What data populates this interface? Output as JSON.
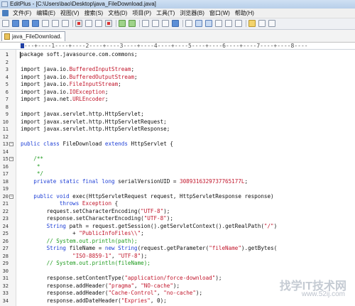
{
  "window": {
    "title": "EditPlus - [C:\\Users\\bao\\Desktop\\java_FileDownload.java]"
  },
  "menu": {
    "items": [
      "文件(F)",
      "编辑(E)",
      "视图(V)",
      "搜索(S)",
      "文档(D)",
      "项目(P)",
      "工具(T)",
      "浏览器(B)",
      "窗口(W)",
      "帮助(H)"
    ]
  },
  "toolbar": {
    "icons": [
      "new-file-icon",
      "open-icon",
      "save-icon",
      "save-all-icon",
      "print-icon",
      "print-preview-icon",
      "spellcheck-icon",
      "cut-icon",
      "copy-icon",
      "paste-icon",
      "delete-icon",
      "undo-icon",
      "redo-icon",
      "find-icon",
      "replace-icon",
      "goto-icon",
      "browser-icon",
      "word-wrap-icon",
      "line-number-icon",
      "ruler-icon",
      "column-select-icon",
      "whitespace-icon",
      "hex-icon",
      "options-icon",
      "user-tool-icon",
      "help-icon"
    ]
  },
  "tabs": [
    {
      "label": "java_FileDownload.",
      "active": true
    }
  ],
  "ruler": {
    "text": "----+----1----+----2----+----3----+----4----+----5----+----6----+----7----+----8----"
  },
  "editor": {
    "current_line": 1,
    "lines": [
      {
        "n": "1",
        "fold": "",
        "segs": [
          [
            "",
            "package soft.javasource.com.commons;"
          ]
        ]
      },
      {
        "n": "2",
        "fold": "",
        "segs": []
      },
      {
        "n": "3",
        "fold": "",
        "segs": [
          [
            "",
            "import java.io."
          ],
          [
            "cls",
            "BufferedInputStream"
          ],
          [
            "",
            ";"
          ]
        ]
      },
      {
        "n": "4",
        "fold": "",
        "segs": [
          [
            "",
            "import java.io."
          ],
          [
            "cls",
            "BufferedOutputStream"
          ],
          [
            "",
            ";"
          ]
        ]
      },
      {
        "n": "5",
        "fold": "",
        "segs": [
          [
            "",
            "import java.io."
          ],
          [
            "cls",
            "FileInputStream"
          ],
          [
            "",
            ";"
          ]
        ]
      },
      {
        "n": "6",
        "fold": "",
        "segs": [
          [
            "",
            "import java.io."
          ],
          [
            "cls",
            "IOException"
          ],
          [
            "",
            ";"
          ]
        ]
      },
      {
        "n": "7",
        "fold": "",
        "segs": [
          [
            "",
            "import java.net."
          ],
          [
            "cls",
            "URLEncoder"
          ],
          [
            "",
            ";"
          ]
        ]
      },
      {
        "n": "8",
        "fold": "",
        "segs": []
      },
      {
        "n": "9",
        "fold": "",
        "segs": [
          [
            "",
            "import javax.servlet.http.HttpServlet;"
          ]
        ]
      },
      {
        "n": "10",
        "fold": "",
        "segs": [
          [
            "",
            "import javax.servlet.http.HttpServletRequest;"
          ]
        ]
      },
      {
        "n": "11",
        "fold": "",
        "segs": [
          [
            "",
            "import javax.servlet.http.HttpServletResponse;"
          ]
        ]
      },
      {
        "n": "12",
        "fold": "",
        "segs": []
      },
      {
        "n": "13",
        "fold": "⊟",
        "segs": [
          [
            "kw",
            "public class"
          ],
          [
            "",
            " FileDownload "
          ],
          [
            "kw",
            "extends"
          ],
          [
            "",
            " HttpServlet {"
          ]
        ]
      },
      {
        "n": "14",
        "fold": "",
        "segs": []
      },
      {
        "n": "15",
        "fold": "⊟",
        "segs": [
          [
            "cm",
            "    /**"
          ]
        ]
      },
      {
        "n": "16",
        "fold": "",
        "segs": [
          [
            "cm",
            "     *"
          ]
        ]
      },
      {
        "n": "17",
        "fold": "",
        "segs": [
          [
            "cm",
            "     */"
          ]
        ]
      },
      {
        "n": "18",
        "fold": "",
        "segs": [
          [
            "kw",
            "    private static final long"
          ],
          [
            "",
            " serialVersionUID = "
          ],
          [
            "st",
            "3089316329737765177L"
          ],
          [
            "",
            ";"
          ]
        ]
      },
      {
        "n": "19",
        "fold": "",
        "segs": []
      },
      {
        "n": "20",
        "fold": "⊟",
        "segs": [
          [
            "kw",
            "    public void"
          ],
          [
            "",
            " exec(HttpServletRequest request, HttpServletResponse response)"
          ]
        ]
      },
      {
        "n": "21",
        "fold": "",
        "segs": [
          [
            "kw",
            "            throws"
          ],
          [
            "",
            " "
          ],
          [
            "cls",
            "Exception"
          ],
          [
            "",
            " {"
          ]
        ]
      },
      {
        "n": "22",
        "fold": "",
        "segs": [
          [
            "",
            "        request.setCharacterEncoding("
          ],
          [
            "st",
            "\"UTF-8\""
          ],
          [
            "",
            ");"
          ]
        ]
      },
      {
        "n": "23",
        "fold": "",
        "segs": [
          [
            "",
            "        response.setCharacterEncoding("
          ],
          [
            "st",
            "\"UTF-8\""
          ],
          [
            "",
            ");"
          ]
        ]
      },
      {
        "n": "24",
        "fold": "",
        "segs": [
          [
            "kw",
            "        String"
          ],
          [
            "",
            " path = request.getSession().getServletContext().getRealPath("
          ],
          [
            "st",
            "\"/\""
          ],
          [
            "",
            ")"
          ]
        ]
      },
      {
        "n": "25",
        "fold": "",
        "segs": [
          [
            "",
            "                + "
          ],
          [
            "st",
            "\"PublicInfoFiles\\\\\""
          ],
          [
            "",
            ";"
          ]
        ]
      },
      {
        "n": "26",
        "fold": "",
        "segs": [
          [
            "cm",
            "        // System.out.println(path);"
          ]
        ]
      },
      {
        "n": "27",
        "fold": "",
        "segs": [
          [
            "kw",
            "        String"
          ],
          [
            "",
            " fileName = "
          ],
          [
            "kw",
            "new String"
          ],
          [
            "",
            "(request.getParameter("
          ],
          [
            "st",
            "\"fileName\""
          ],
          [
            "",
            ").getBytes("
          ]
        ]
      },
      {
        "n": "28",
        "fold": "",
        "segs": [
          [
            "",
            "                "
          ],
          [
            "st",
            "\"ISO-8859-1\""
          ],
          [
            "",
            ", "
          ],
          [
            "st",
            "\"UTF-8\""
          ],
          [
            "",
            ");"
          ]
        ]
      },
      {
        "n": "29",
        "fold": "",
        "segs": [
          [
            "cm",
            "        // System.out.println(fileName);"
          ]
        ]
      },
      {
        "n": "30",
        "fold": "",
        "segs": []
      },
      {
        "n": "31",
        "fold": "",
        "segs": [
          [
            "",
            "        response.setContentType("
          ],
          [
            "st",
            "\"application/force-download\""
          ],
          [
            "",
            ");"
          ]
        ]
      },
      {
        "n": "32",
        "fold": "",
        "segs": [
          [
            "",
            "        response.addHeader("
          ],
          [
            "st",
            "\"pragma\""
          ],
          [
            "",
            ", "
          ],
          [
            "st",
            "\"NO-cache\""
          ],
          [
            "",
            ");"
          ]
        ]
      },
      {
        "n": "33",
        "fold": "",
        "segs": [
          [
            "",
            "        response.addHeader("
          ],
          [
            "st",
            "\"Cache-Control\""
          ],
          [
            "",
            ", "
          ],
          [
            "st",
            "\"no-cache\""
          ],
          [
            "",
            ");"
          ]
        ]
      },
      {
        "n": "34",
        "fold": "",
        "segs": [
          [
            "",
            "        response.addDateHeader("
          ],
          [
            "st",
            "\"Expries\""
          ],
          [
            "",
            ", 0);"
          ]
        ]
      }
    ]
  },
  "watermark": {
    "line1": "找学IT技术网",
    "line2": "www.52ij.com"
  }
}
